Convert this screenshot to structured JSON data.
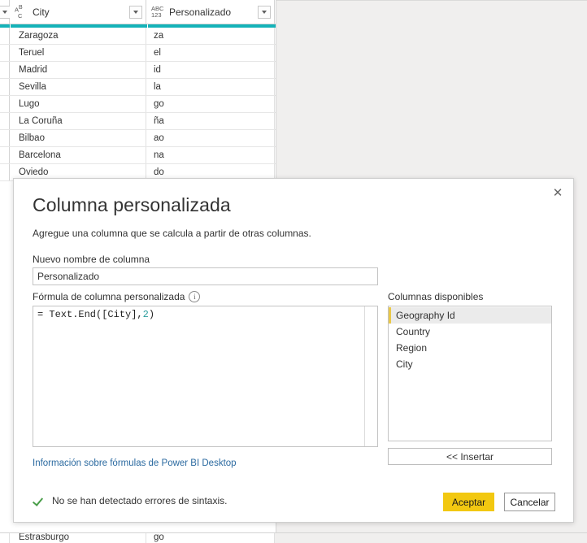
{
  "grid": {
    "columns": [
      {
        "name": "City",
        "type_icon": "abc-text-icon",
        "type_glyph_top": "A B",
        "type_glyph_bot": "C"
      },
      {
        "name": "Personalizado",
        "type_icon": "abc123-any-icon",
        "type_glyph_top": "ABC",
        "type_glyph_bot": "123"
      }
    ],
    "header_accent_color": "#14b2b8",
    "rows": [
      {
        "city": "Zaragoza",
        "custom": "za"
      },
      {
        "city": "Teruel",
        "custom": "el"
      },
      {
        "city": "Madrid",
        "custom": "id"
      },
      {
        "city": "Sevilla",
        "custom": "la"
      },
      {
        "city": "Lugo",
        "custom": "go"
      },
      {
        "city": "La Coruña",
        "custom": "ña"
      },
      {
        "city": "Bilbao",
        "custom": "ao"
      },
      {
        "city": "Barcelona",
        "custom": "na"
      },
      {
        "city": "Oviedo",
        "custom": "do"
      }
    ],
    "bottom_partial_row": {
      "city": "Estrasburgo",
      "custom": "go"
    }
  },
  "dialog": {
    "title": "Columna personalizada",
    "subtitle": "Agregue una columna que se calcula a partir de otras columnas.",
    "close_label": "✕",
    "new_column_name_label": "Nuevo nombre de columna",
    "new_column_name_value": "Personalizado",
    "new_column_name_placeholder": "Nuevo nombre de columna",
    "formula_label": "Fórmula de columna personalizada",
    "info_icon_glyph": "i",
    "formula_prefix": "= Text.End([City],",
    "formula_number": "2",
    "formula_suffix": ")",
    "formula_full": "= Text.End([City],2)",
    "help_link": "Información sobre fórmulas de Power BI Desktop",
    "status_text": "No se han detectado errores de sintaxis.",
    "status_color": "#4a9e4a",
    "available_columns_label": "Columnas disponibles",
    "available_columns": [
      {
        "label": "Geography Id",
        "selected": true
      },
      {
        "label": "Country",
        "selected": false
      },
      {
        "label": "Region",
        "selected": false
      },
      {
        "label": "City",
        "selected": false
      }
    ],
    "insert_button": "<< Insertar",
    "ok_button": "Aceptar",
    "cancel_button": "Cancelar",
    "ok_button_color": "#f2c811"
  }
}
